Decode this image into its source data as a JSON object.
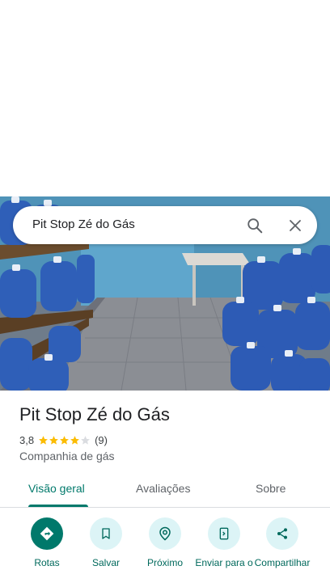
{
  "search": {
    "query": "Pit Stop Zé do Gás"
  },
  "place": {
    "name": "Pit Stop Zé do Gás",
    "rating": "3,8",
    "rating_value": 3.8,
    "review_count": "(9)",
    "category": "Companhia de gás"
  },
  "tabs": [
    {
      "label": "Visão geral",
      "active": true
    },
    {
      "label": "Avaliações",
      "active": false
    },
    {
      "label": "Sobre",
      "active": false
    }
  ],
  "actions": [
    {
      "label": "Rotas",
      "icon": "directions-icon"
    },
    {
      "label": "Salvar",
      "icon": "bookmark-icon"
    },
    {
      "label": "Próximo",
      "icon": "nearby-icon"
    },
    {
      "label": "Enviar para o",
      "icon": "send-to-phone-icon"
    },
    {
      "label": "Compartilhar",
      "icon": "share-icon"
    }
  ],
  "colors": {
    "accent": "#00796b",
    "action_bg": "#dcf4f6",
    "star": "#fbbc04",
    "star_empty": "#dadce0"
  }
}
